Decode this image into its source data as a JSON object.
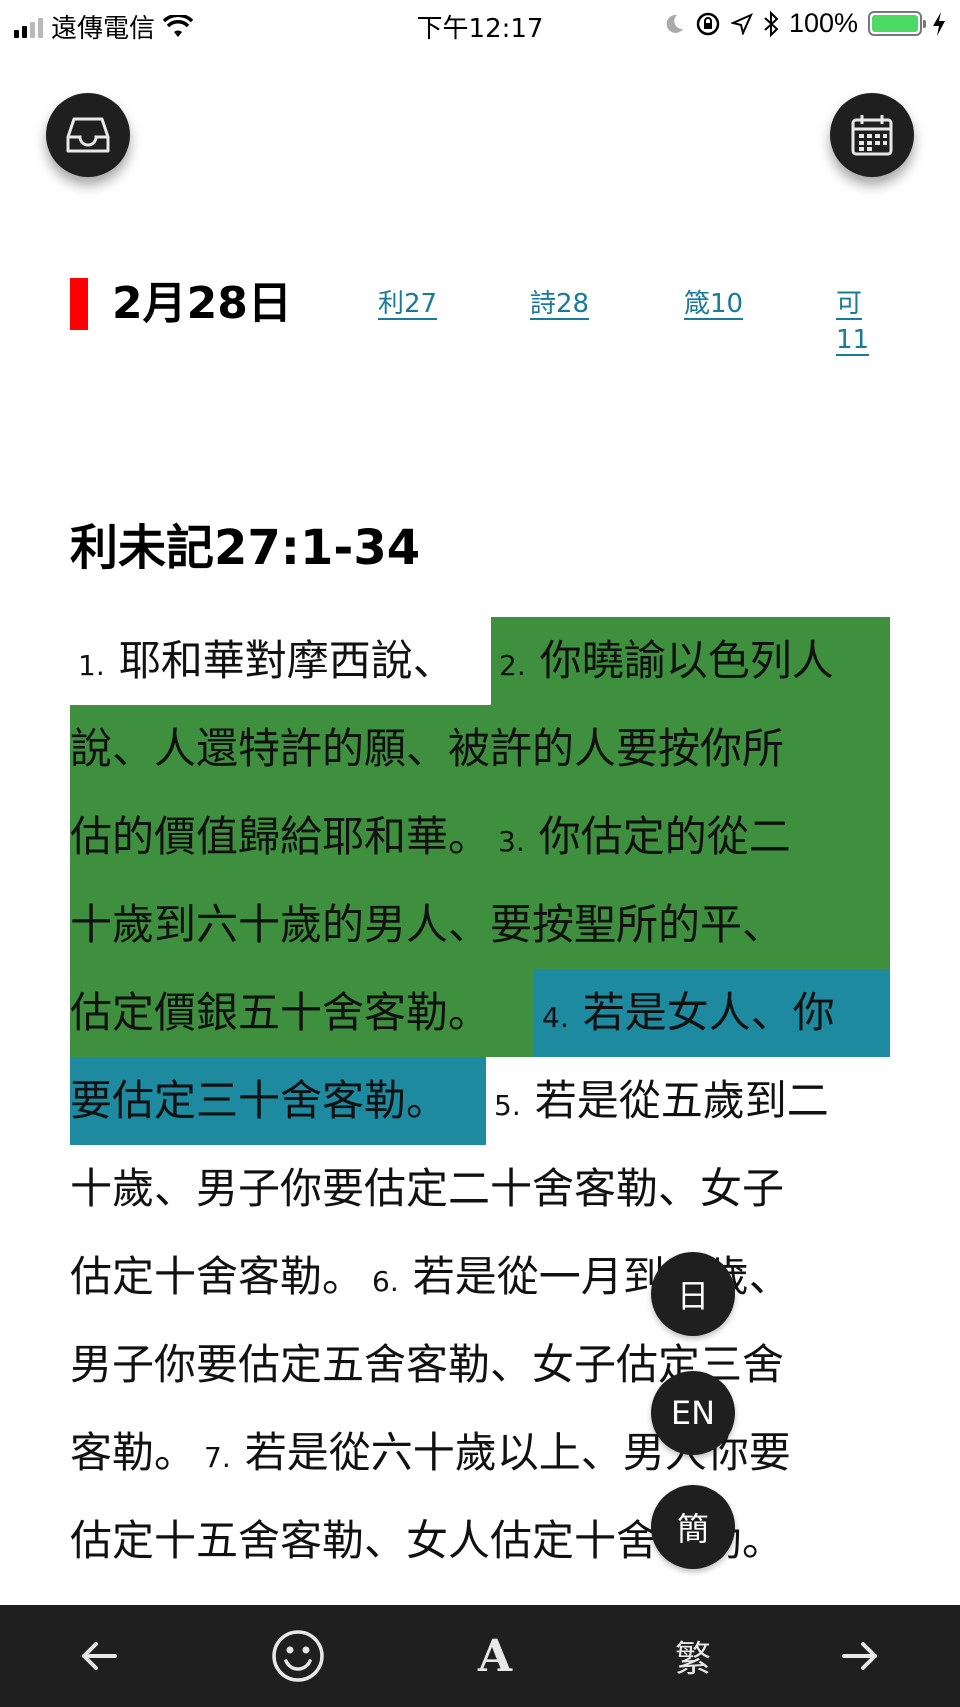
{
  "status_bar": {
    "carrier": "遠傳電信",
    "time": "下午12:17",
    "battery": "100%",
    "battery_level": 1.0
  },
  "header": {
    "date": "2月28日",
    "readings": [
      "利27",
      "詩28",
      "箴10",
      "可11"
    ]
  },
  "passage": {
    "title": "利未記27:1-34",
    "lines": [
      [
        {
          "n": "1.",
          "t": "耶和華對摩西說、"
        },
        {
          "n": "2.",
          "t": "你曉諭以色列人"
        }
      ],
      [
        {
          "t": "說、人還特許的願、被許的人要按你所"
        }
      ],
      [
        {
          "t": "估的價值歸給耶和華。"
        },
        {
          "n": "3.",
          "t": "你估定的從二"
        }
      ],
      [
        {
          "t": "十歲到六十歲的男人、要按聖所的平、"
        }
      ],
      [
        {
          "t": "估定價銀五十舍客勒。"
        },
        {
          "n": "4.",
          "t": "若是女人、你"
        }
      ],
      [
        {
          "t": "要估定三十舍客勒。"
        },
        {
          "n": "5.",
          "t": "若是從五歲到二"
        }
      ],
      [
        {
          "t": "十歲、男子你要估定二十舍客勒、女子"
        }
      ],
      [
        {
          "t": "估定十舍客勒。"
        },
        {
          "n": "6.",
          "t": "若是從一月到五歲、"
        }
      ],
      [
        {
          "t": "男子你要估定五舍客勒、女子估定三舍"
        }
      ],
      [
        {
          "t": "客勒。"
        },
        {
          "n": "7.",
          "t": "若是從六十歲以上、男人你要"
        }
      ],
      [
        {
          "t": "估定十五舍客勒、女人估定十舍客勒。"
        }
      ]
    ]
  },
  "lang_buttons": [
    "日",
    "EN",
    "簡"
  ],
  "toolbar": {
    "traditional_label": "繁",
    "font_label": "A"
  },
  "colors": {
    "highlight_green": "#3e8f3e",
    "highlight_blue": "#1d8aa0",
    "date_marker": "#ff0000",
    "link": "#1a7a9a"
  }
}
